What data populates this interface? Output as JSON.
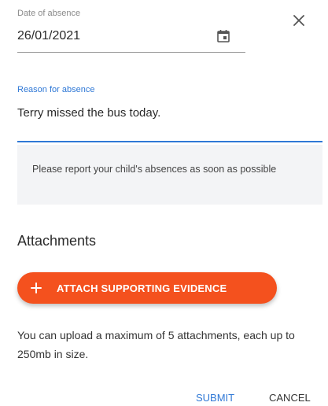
{
  "date_field": {
    "label": "Date of absence",
    "value": "26/01/2021"
  },
  "reason_field": {
    "label": "Reason for absence",
    "value": "Terry missed the bus today."
  },
  "notice": {
    "text": "Please report your child's absences as soon as possible"
  },
  "attachments": {
    "heading": "Attachments",
    "button_label": "ATTACH SUPPORTING EVIDENCE",
    "info": "You can upload a maximum of 5 attachments, each up to 250mb in size."
  },
  "actions": {
    "submit_label": "SUBMIT",
    "cancel_label": "CANCEL"
  },
  "icons": {
    "close": "close-icon",
    "calendar": "calendar-icon",
    "plus": "plus-icon"
  },
  "colors": {
    "accent_blue": "#2f78d6",
    "attach_button": "#f4511e",
    "notice_background": "#f3f4f6"
  }
}
